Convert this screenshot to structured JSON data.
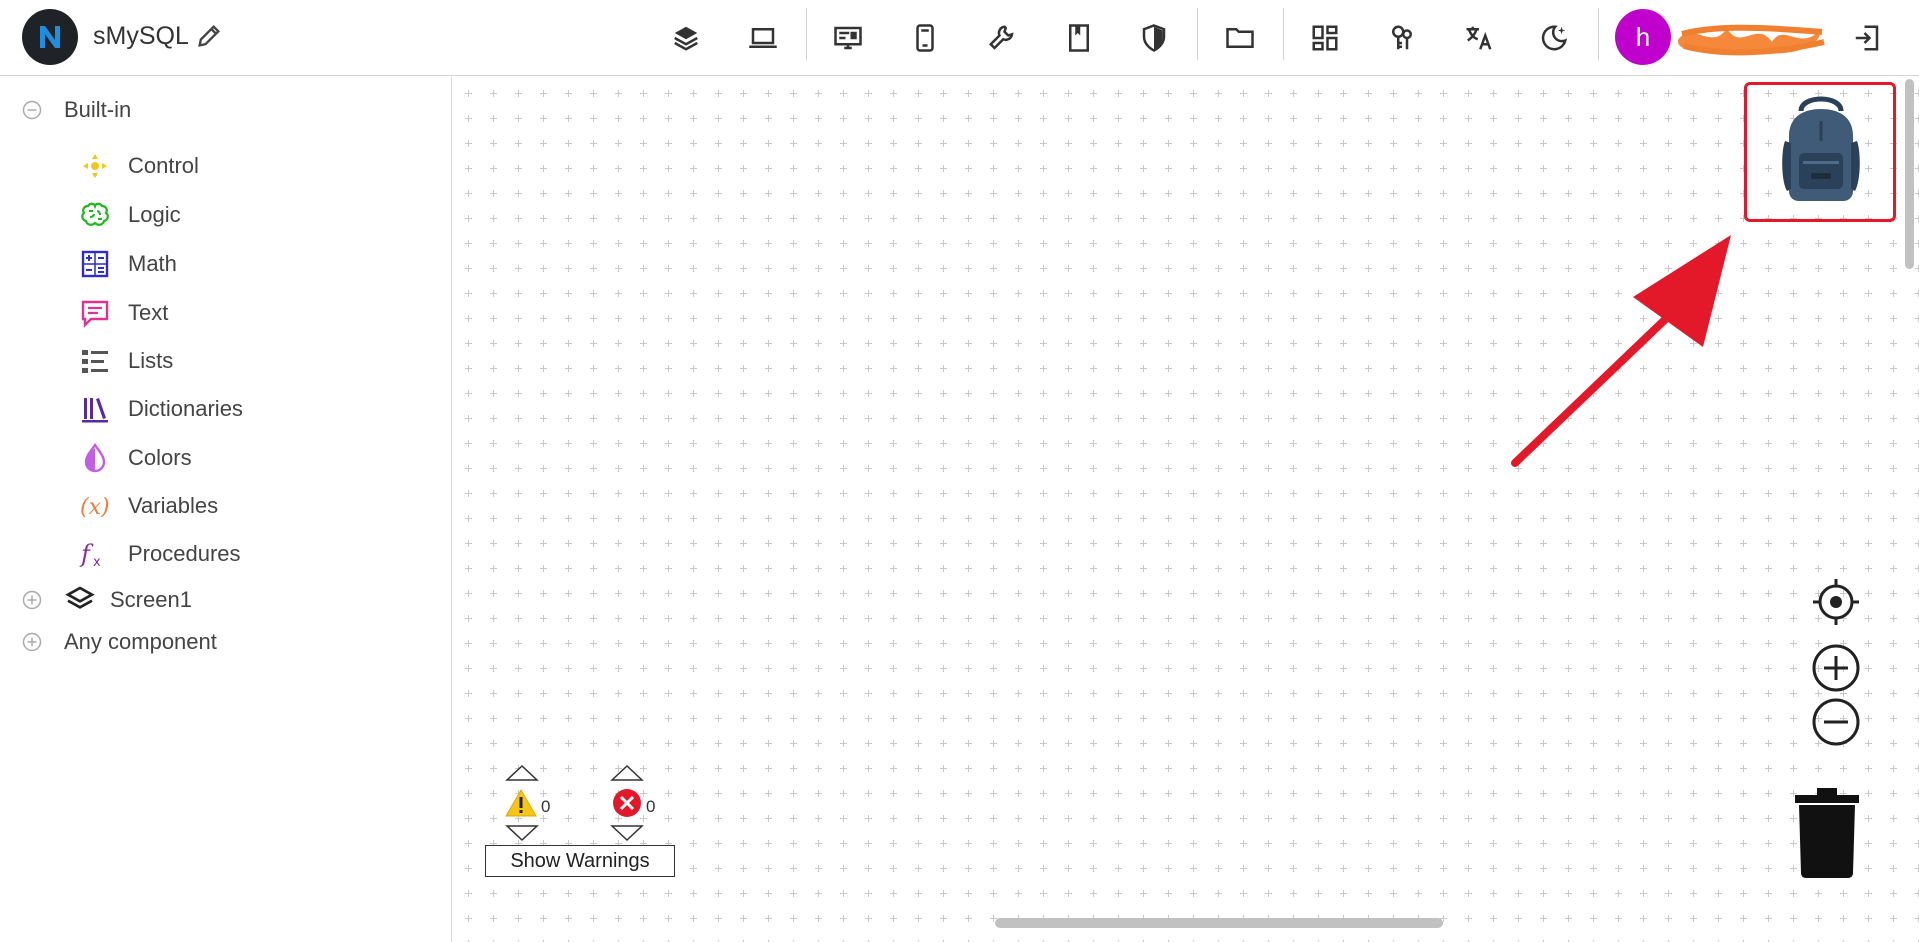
{
  "app": {
    "project_name": "sMySQL",
    "user_initial": "h"
  },
  "toolbar": {
    "tools": [
      "layers-icon",
      "laptop-icon",
      "monitor-icon",
      "phone-icon",
      "wrench-icon",
      "book-icon",
      "shield-icon",
      "folder-icon",
      "dashboard-icon",
      "keys-icon",
      "translate-icon",
      "dark-mode-icon",
      "logout-icon"
    ]
  },
  "sidebar": {
    "builtin_label": "Built-in",
    "categories": [
      {
        "label": "Control",
        "color": "#f5c518"
      },
      {
        "label": "Logic",
        "color": "#1db81d"
      },
      {
        "label": "Math",
        "color": "#2c2ccf"
      },
      {
        "label": "Text",
        "color": "#e0338f"
      },
      {
        "label": "Lists",
        "color": "#555555"
      },
      {
        "label": "Dictionaries",
        "color": "#5a2aa5"
      },
      {
        "label": "Colors",
        "color": "#c65ce6"
      },
      {
        "label": "Variables",
        "color": "#ef7a3a"
      },
      {
        "label": "Procedures",
        "color": "#8a2a9c"
      }
    ],
    "screen_label": "Screen1",
    "any_component_label": "Any component"
  },
  "workspace": {
    "warning_count": "0",
    "error_count": "0",
    "show_warnings_label": "Show Warnings",
    "highlight_color": "#e3192a"
  }
}
